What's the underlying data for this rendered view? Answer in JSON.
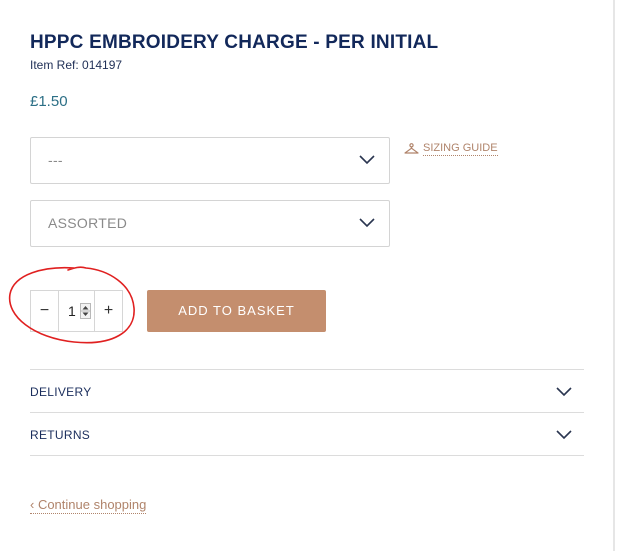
{
  "product": {
    "title": "HPPC EMBROIDERY CHARGE - PER INITIAL",
    "item_ref": "Item Ref: 014197",
    "price": "£1.50"
  },
  "selects": [
    {
      "value": "---",
      "icon": "chevron-down-icon"
    },
    {
      "value": "ASSORTED",
      "icon": "chevron-down-icon"
    }
  ],
  "sizing_guide": {
    "label": "SIZING GUIDE",
    "icon": "hanger-icon"
  },
  "quantity": {
    "minus": "−",
    "value": "1",
    "plus": "+"
  },
  "add_to_basket": {
    "label": "ADD TO BASKET"
  },
  "accordion": [
    {
      "label": "DELIVERY"
    },
    {
      "label": "RETURNS"
    }
  ],
  "continue_link": "‹ Continue shopping",
  "colors": {
    "title": "#12285a",
    "price": "#2c6f86",
    "accent": "#c48e6e",
    "annotation": "#e02020"
  }
}
